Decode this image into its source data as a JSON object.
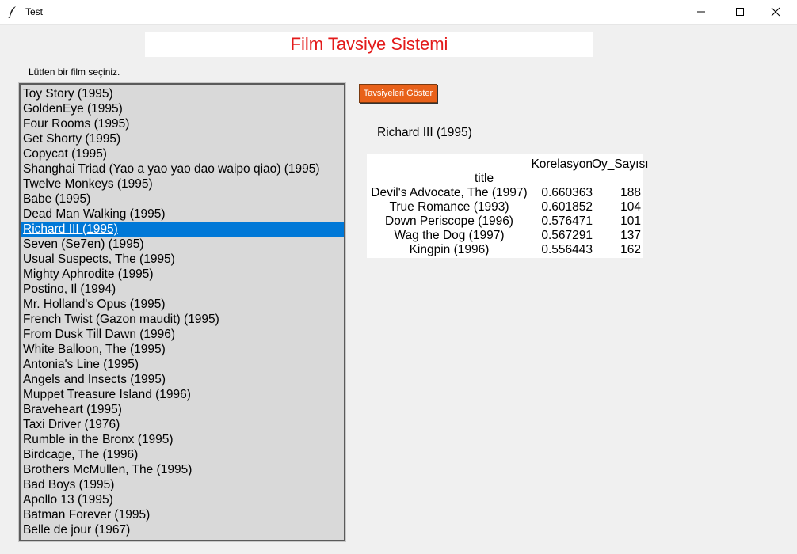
{
  "window": {
    "title": "Test",
    "controls": {
      "minimize_icon": "minimize-icon",
      "maximize_icon": "maximize-icon",
      "close_icon": "close-icon"
    }
  },
  "header": {
    "title": "Film Tavsiye Sistemi",
    "title_color": "#e31b1b"
  },
  "prompt": "Lütfen bir film seçiniz.",
  "movie_list": {
    "items": [
      "Toy Story (1995)",
      "GoldenEye (1995)",
      "Four Rooms (1995)",
      "Get Shorty (1995)",
      "Copycat (1995)",
      "Shanghai Triad (Yao a yao yao dao waipo qiao) (1995)",
      "Twelve Monkeys (1995)",
      "Babe (1995)",
      "Dead Man Walking (1995)",
      "Richard III (1995)",
      "Seven (Se7en) (1995)",
      "Usual Suspects, The (1995)",
      "Mighty Aphrodite (1995)",
      "Postino, Il (1994)",
      "Mr. Holland's Opus (1995)",
      "French Twist (Gazon maudit) (1995)",
      "From Dusk Till Dawn (1996)",
      "White Balloon, The (1995)",
      "Antonia's Line (1995)",
      "Angels and Insects (1995)",
      "Muppet Treasure Island (1996)",
      "Braveheart (1995)",
      "Taxi Driver (1976)",
      "Rumble in the Bronx (1995)",
      "Birdcage, The (1996)",
      "Brothers McMullen, The (1995)",
      "Bad Boys (1995)",
      "Apollo 13 (1995)",
      "Batman Forever (1995)",
      "Belle de jour (1967)"
    ],
    "selected_index": 9,
    "selection_color": "#0078d7"
  },
  "show_button": {
    "label": "Tavsiyeleri Göster",
    "color": "#e8611a"
  },
  "selected_movie": "Richard III (1995)",
  "results": {
    "headers": {
      "correlation": "Korelasyon",
      "votes": "Oy_Sayısı",
      "index": "title"
    },
    "rows": [
      {
        "title": "Devil's Advocate, The (1997)",
        "correlation": "0.660363",
        "votes": "188"
      },
      {
        "title": "True Romance (1993)",
        "correlation": "0.601852",
        "votes": "104"
      },
      {
        "title": "Down Periscope (1996)",
        "correlation": "0.576471",
        "votes": "101"
      },
      {
        "title": "Wag the Dog (1997)",
        "correlation": "0.567291",
        "votes": "137"
      },
      {
        "title": "Kingpin (1996)",
        "correlation": "0.556443",
        "votes": "162"
      }
    ]
  }
}
